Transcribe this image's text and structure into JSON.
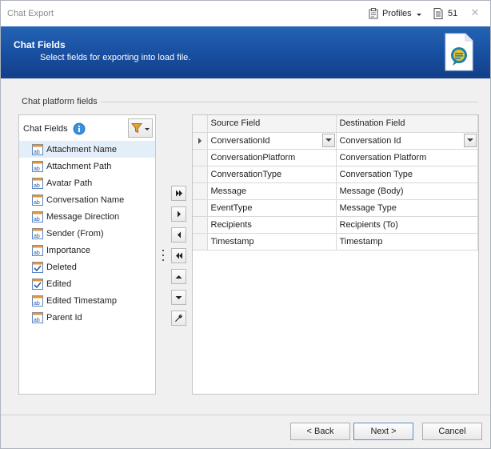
{
  "window": {
    "title": "Chat Export",
    "profiles_label": "Profiles",
    "count_label": "51",
    "close_glyph": "✕"
  },
  "banner": {
    "title": "Chat Fields",
    "subtitle": "Select fields for exporting into load file."
  },
  "group": {
    "label": "Chat platform fields"
  },
  "left_panel": {
    "title": "Chat Fields",
    "items": [
      {
        "label": "Attachment Name",
        "icon": "text-field-icon",
        "selected": true
      },
      {
        "label": "Attachment Path",
        "icon": "text-field-icon"
      },
      {
        "label": "Avatar Path",
        "icon": "text-field-icon"
      },
      {
        "label": "Conversation Name",
        "icon": "text-field-icon"
      },
      {
        "label": "Message Direction",
        "icon": "text-field-icon"
      },
      {
        "label": "Sender (From)",
        "icon": "text-field-icon"
      },
      {
        "label": "Importance",
        "icon": "text-field-icon"
      },
      {
        "label": "Deleted",
        "icon": "boolean-field-icon"
      },
      {
        "label": "Edited",
        "icon": "boolean-field-icon"
      },
      {
        "label": "Edited Timestamp",
        "icon": "text-field-icon"
      },
      {
        "label": "Parent Id",
        "icon": "text-field-icon"
      }
    ]
  },
  "move_buttons": [
    "add-all-icon",
    "add-icon",
    "remove-icon",
    "remove-all-icon",
    "move-up-icon",
    "move-down-icon",
    "wrench-icon"
  ],
  "grid": {
    "columns": [
      "Source Field",
      "Destination Field"
    ],
    "rows": [
      {
        "source": "ConversationId",
        "destination": "Conversation Id",
        "current": true
      },
      {
        "source": "ConversationPlatform",
        "destination": "Conversation Platform"
      },
      {
        "source": "ConversationType",
        "destination": "Conversation Type"
      },
      {
        "source": "Message",
        "destination": "Message (Body)"
      },
      {
        "source": "EventType",
        "destination": "Message Type"
      },
      {
        "source": "Recipients",
        "destination": "Recipients (To)"
      },
      {
        "source": "Timestamp",
        "destination": "Timestamp"
      }
    ]
  },
  "footer": {
    "back_label": "< Back",
    "next_label": "Next >",
    "cancel_label": "Cancel"
  },
  "colors": {
    "banner": "#1a52a3",
    "selection": "#e4eef9",
    "text_field_icon": "#d98a2b"
  }
}
